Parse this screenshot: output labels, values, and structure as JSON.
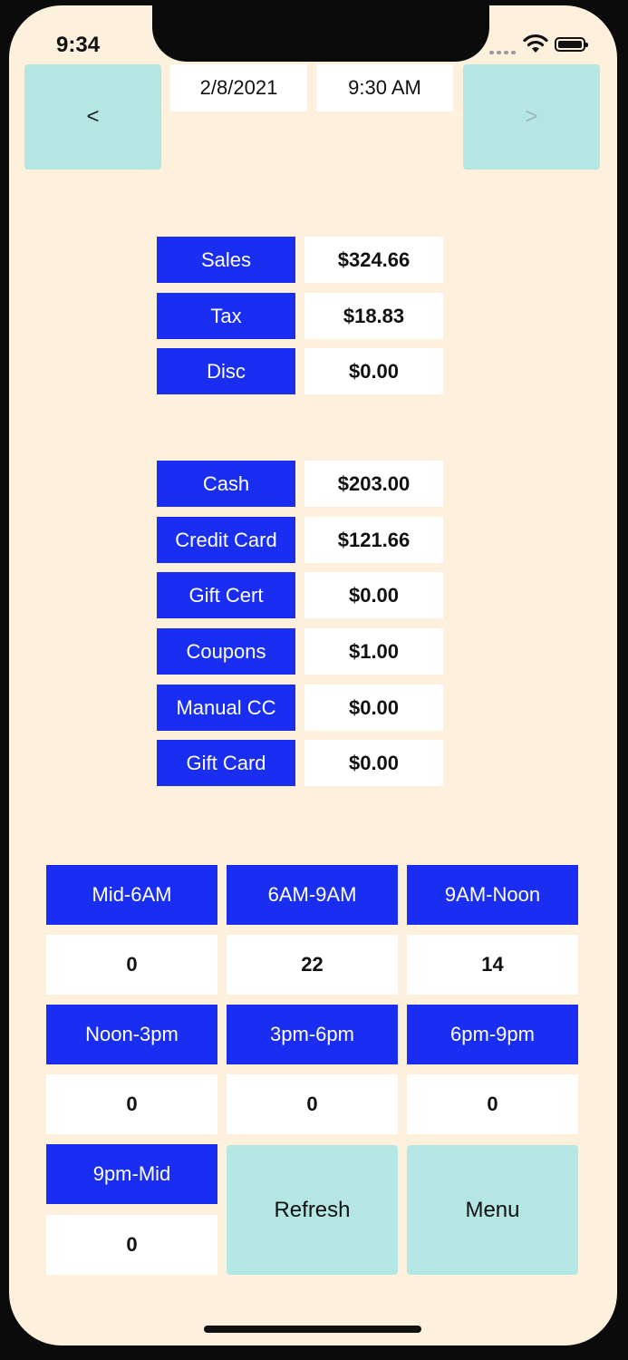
{
  "status_bar": {
    "time": "9:34"
  },
  "header": {
    "prev_label": "<",
    "next_label": ">",
    "date": "2/8/2021",
    "time": "9:30 AM"
  },
  "totals": [
    {
      "label": "Sales",
      "value": "$324.66"
    },
    {
      "label": "Tax",
      "value": "$18.83"
    },
    {
      "label": "Disc",
      "value": "$0.00"
    }
  ],
  "payments": [
    {
      "label": "Cash",
      "value": "$203.00"
    },
    {
      "label": "Credit Card",
      "value": "$121.66"
    },
    {
      "label": "Gift Cert",
      "value": "$0.00"
    },
    {
      "label": "Coupons",
      "value": "$1.00"
    },
    {
      "label": "Manual CC",
      "value": "$0.00"
    },
    {
      "label": "Gift Card",
      "value": "$0.00"
    }
  ],
  "hours": [
    {
      "label": "Mid-6AM",
      "value": "0"
    },
    {
      "label": "6AM-9AM",
      "value": "22"
    },
    {
      "label": "9AM-Noon",
      "value": "14"
    },
    {
      "label": "Noon-3pm",
      "value": "0"
    },
    {
      "label": "3pm-6pm",
      "value": "0"
    },
    {
      "label": "6pm-9pm",
      "value": "0"
    },
    {
      "label": "9pm-Mid",
      "value": "0"
    }
  ],
  "actions": {
    "refresh_label": "Refresh",
    "menu_label": "Menu"
  },
  "colors": {
    "accent_blue": "#1a2ef2",
    "button_teal": "#b4e6e4",
    "background": "#fdf0dd"
  }
}
